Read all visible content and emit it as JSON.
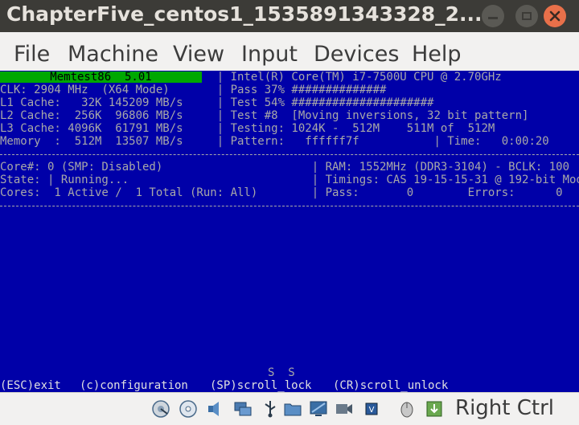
{
  "window": {
    "title": "ChapterFive_centos1_1535891343328_2...",
    "controls": [
      "minimize",
      "maximize",
      "close"
    ],
    "close_color": "#e8704a"
  },
  "menubar": {
    "items": [
      "File",
      "Machine",
      "View",
      "Input",
      "Devices",
      "Help"
    ]
  },
  "memtest": {
    "banner": "Memtest86  5.01",
    "colors": {
      "background": "#0000a8",
      "banner": "#00a800",
      "text": "#a8a8a8"
    },
    "lines": [
      "                                | Intel(R) Core(TM) i7-7500U CPU @ 2.70GHz",
      "CLK: 2904 MHz  (X64 Mode)       | Pass 37% ##############",
      "L1 Cache:   32K 145209 MB/s     | Test 54% #####################",
      "L2 Cache:  256K  96806 MB/s     | Test #8  [Moving inversions, 32 bit pattern]",
      "L3 Cache: 4096K  61791 MB/s     | Testing: 1024K -  512M    511M of  512M",
      "Memory  :  512M  13507 MB/s     | Pattern:   ffffff7f           | Time:   0:00:20",
      "",
      "Core#: 0 (SMP: Disabled)                      | RAM: 1552MHz (DDR3-3104) - BCLK: 100",
      "State: | Running...                           | Timings: CAS 19-15-15-31 @ 192-bit Mode",
      "Cores:  1 Active /  1 Total (Run: All)        | Pass:       0        Errors:      0"
    ],
    "scroll_indicator": "S  S",
    "commands": [
      "(ESC)exit",
      "(c)configuration",
      "(SP)scroll_lock",
      "(CR)scroll_unlock"
    ]
  },
  "statusbar": {
    "icons": [
      "hard-disk-icon",
      "optical-drive-icon",
      "audio-icon",
      "network-icon",
      "usb-icon",
      "shared-folders-icon",
      "display-icon",
      "video-capture-icon",
      "cpu-icon",
      "mouse-integration-icon",
      "keyboard-capture-icon"
    ],
    "host_key": "Right Ctrl"
  }
}
